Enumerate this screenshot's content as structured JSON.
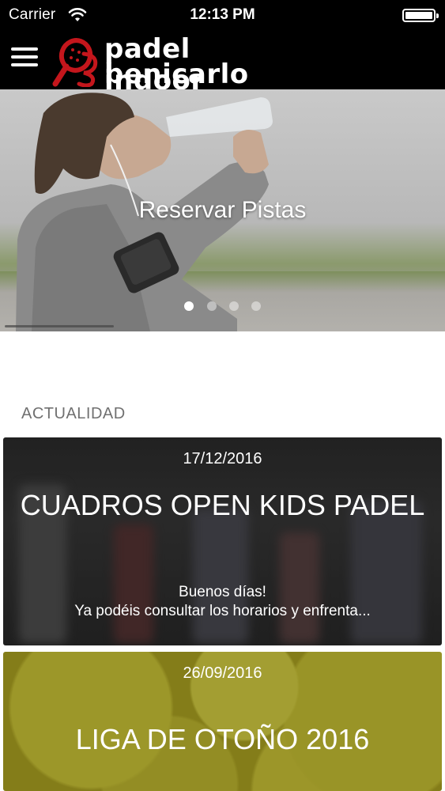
{
  "status_bar": {
    "carrier": "Carrier",
    "time": "12:13 PM"
  },
  "header": {
    "logo_line1": "padel indoor",
    "logo_line2": "benicarlo",
    "menu_icon": "hamburger-menu-icon",
    "brand_colors": {
      "red": "#c4161c",
      "ball": "#d8e23a"
    }
  },
  "hero": {
    "title": "Reservar Pistas",
    "slides_total": 4,
    "active_slide": 1
  },
  "news": {
    "section_title": "ACTUALIDAD",
    "items": [
      {
        "date": "17/12/2016",
        "title": "CUADROS OPEN KIDS PADEL",
        "excerpt": "Buenos días!\nYa podéis consultar los horarios y enfrenta..."
      },
      {
        "date": "26/09/2016",
        "title": "LIGA DE OTOÑO 2016",
        "excerpt": ""
      }
    ]
  }
}
